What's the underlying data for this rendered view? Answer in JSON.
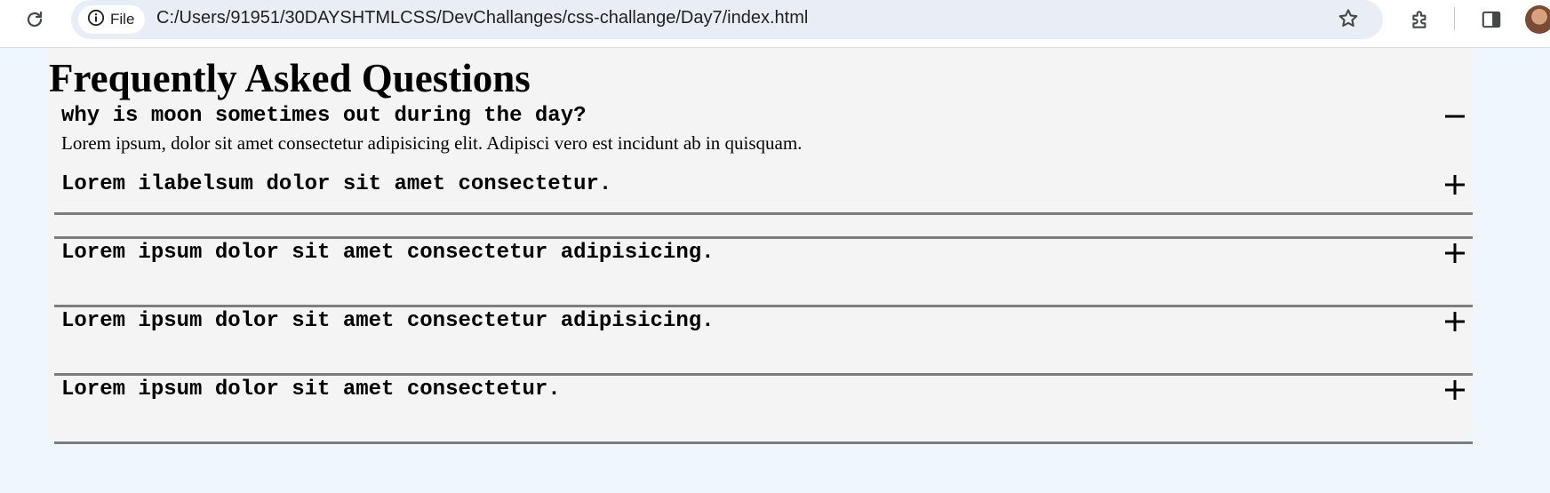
{
  "browser": {
    "site_chip_label": "File",
    "url": "C:/Users/91951/30DAYSHTMLCSS/DevChallanges/css-challange/Day7/index.html",
    "icons": [
      "reload-icon",
      "info-icon",
      "star-icon",
      "extensions-icon",
      "side-panel-icon",
      "avatar"
    ]
  },
  "page": {
    "title": "Frequently Asked Questions",
    "faqs": [
      {
        "question": "why is moon sometimes out during the day?",
        "answer": "Lorem ipsum, dolor sit amet consectetur adipisicing elit. Adipisci vero est incidunt ab in quisquam.",
        "expanded": true,
        "icon": "minus-icon"
      },
      {
        "question": "Lorem ilabelsum dolor sit amet consectetur.",
        "expanded": false,
        "icon": "plus-icon"
      },
      {
        "question": "Lorem ipsum dolor sit amet consectetur adipisicing.",
        "expanded": false,
        "icon": "plus-icon"
      },
      {
        "question": "Lorem ipsum dolor sit amet consectetur adipisicing.",
        "expanded": false,
        "icon": "plus-icon"
      },
      {
        "question": "Lorem ipsum dolor sit amet consectetur.",
        "expanded": false,
        "icon": "plus-icon"
      }
    ]
  },
  "colors": {
    "page_background": "#f0f6fd",
    "faq_background": "#f4f4f4",
    "divider": "#7d7d7d",
    "omnibox": "#e9eef6"
  }
}
